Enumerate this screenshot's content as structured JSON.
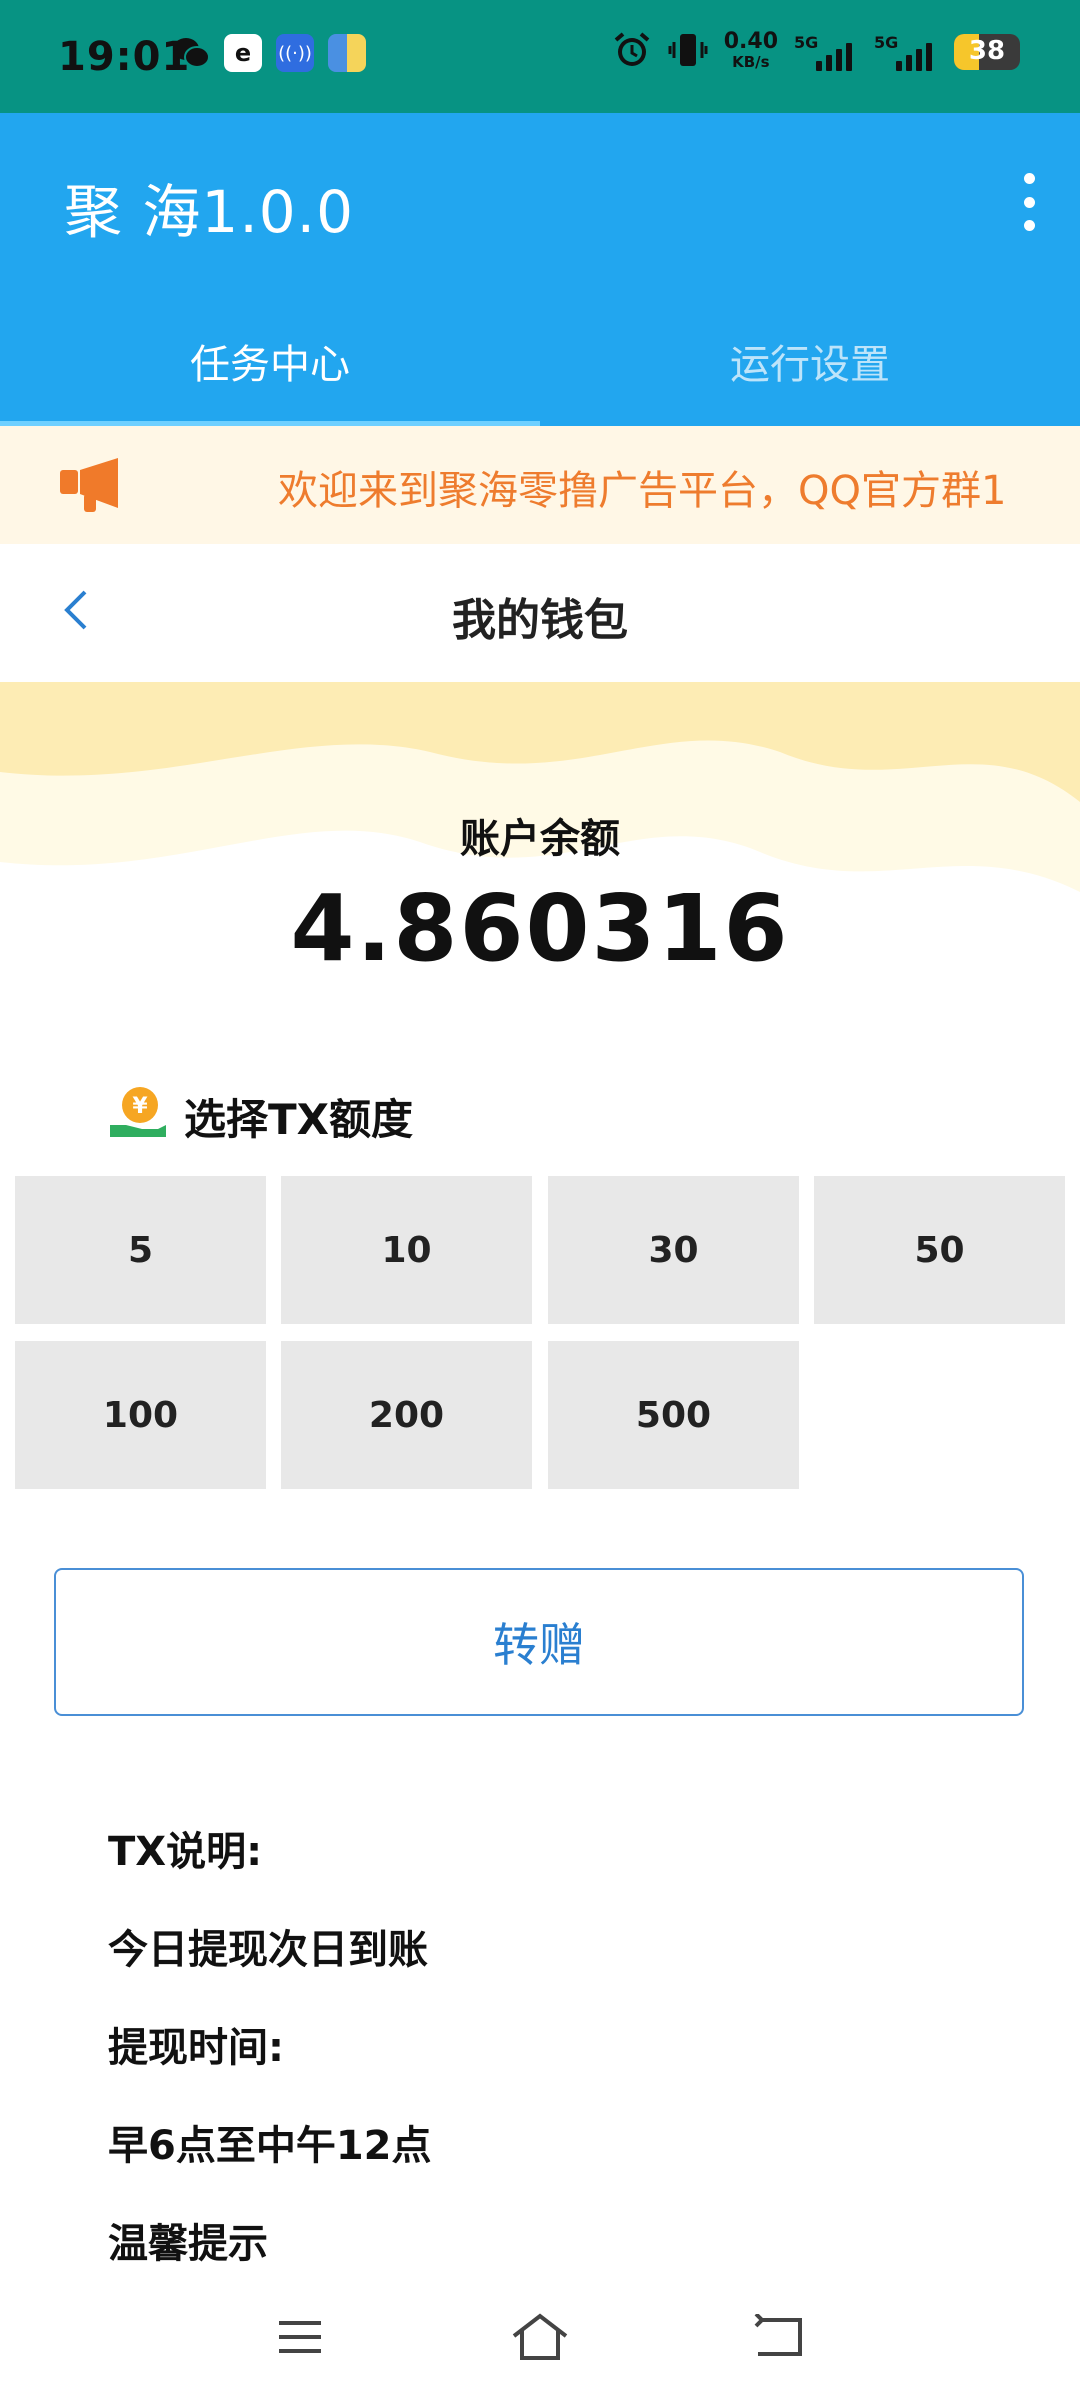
{
  "status_bar": {
    "time": "19:01",
    "net_speed": "0.40",
    "net_unit": "KB/s",
    "sim1": "5G",
    "sim2": "5G",
    "battery": "38",
    "battery_level": 0.38,
    "icons": [
      "wechat-icon",
      "chrome-icon",
      "nfc-icon",
      "app-icon",
      "alarm-icon",
      "vibrate-icon"
    ]
  },
  "appbar": {
    "title": "聚 海1.0.0",
    "menu_icon": "more-vertical-icon"
  },
  "tabs": [
    {
      "label": "任务中心",
      "active": true
    },
    {
      "label": "运行设置",
      "active": false
    }
  ],
  "notice": {
    "icon": "megaphone-icon",
    "text": "欢迎来到聚海零撸广告平台，QQ官方群1"
  },
  "page": {
    "title": "我的钱包",
    "back_icon": "chevron-left-icon"
  },
  "balance": {
    "label": "账户余额",
    "value": "4.860316"
  },
  "select": {
    "icon": "money-hand-icon",
    "title": "选择TX额度",
    "amounts": [
      "5",
      "10",
      "30",
      "50",
      "100",
      "200",
      "500"
    ]
  },
  "transfer_label": "转赠",
  "info": [
    "TX说明:",
    "今日提现次日到账",
    "提现时间:",
    "早6点至中午12点",
    "温馨提示"
  ],
  "colors": {
    "status_bar": "#079383",
    "appbar": "#22a6ef",
    "notice_bg": "#fff7e6",
    "notice_text": "#ee7c2e",
    "amount_bg": "#e8e8e8",
    "button_border": "#4a8fd6"
  },
  "navbar": [
    "menu-icon",
    "home-icon",
    "back-icon"
  ]
}
